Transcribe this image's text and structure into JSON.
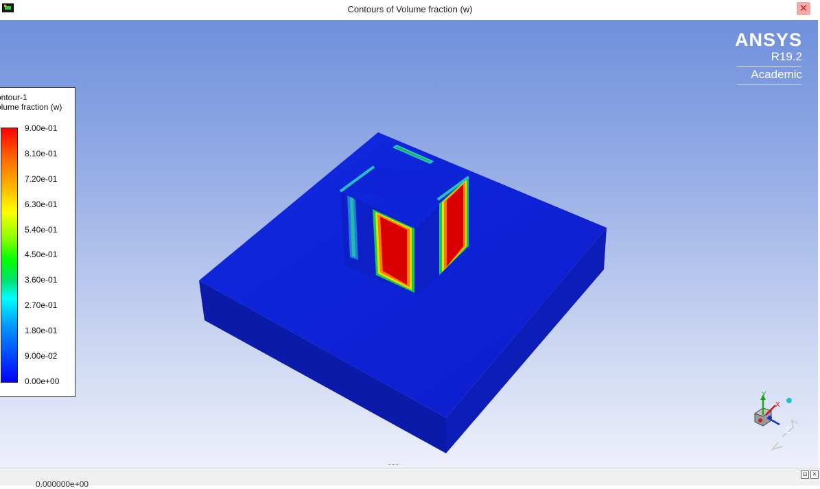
{
  "window": {
    "title": "Contours of Volume fraction (w)",
    "close_label": "✕"
  },
  "legend": {
    "title_lines": [
      "ontour-1",
      "olume fraction (w)"
    ],
    "ticks": [
      "9.00e-01",
      "8.10e-01",
      "7.20e-01",
      "6.30e-01",
      "5.40e-01",
      "4.50e-01",
      "3.60e-01",
      "2.70e-01",
      "1.80e-01",
      "9.00e-02",
      "0.00e+00"
    ]
  },
  "logo": {
    "brand": "ANSYS",
    "release": "R19.2",
    "edition": "Academic"
  },
  "triad": {
    "x": "X",
    "y": "Y",
    "z": "Z"
  },
  "bottom": {
    "text": "0.000000e+00",
    "btn_restore": "⊡",
    "btn_close": "✕"
  },
  "colors": {
    "low": "#0000ff",
    "high": "#ff0000",
    "block_top": "#0f1fd8",
    "block_side": "#0d1dac"
  }
}
